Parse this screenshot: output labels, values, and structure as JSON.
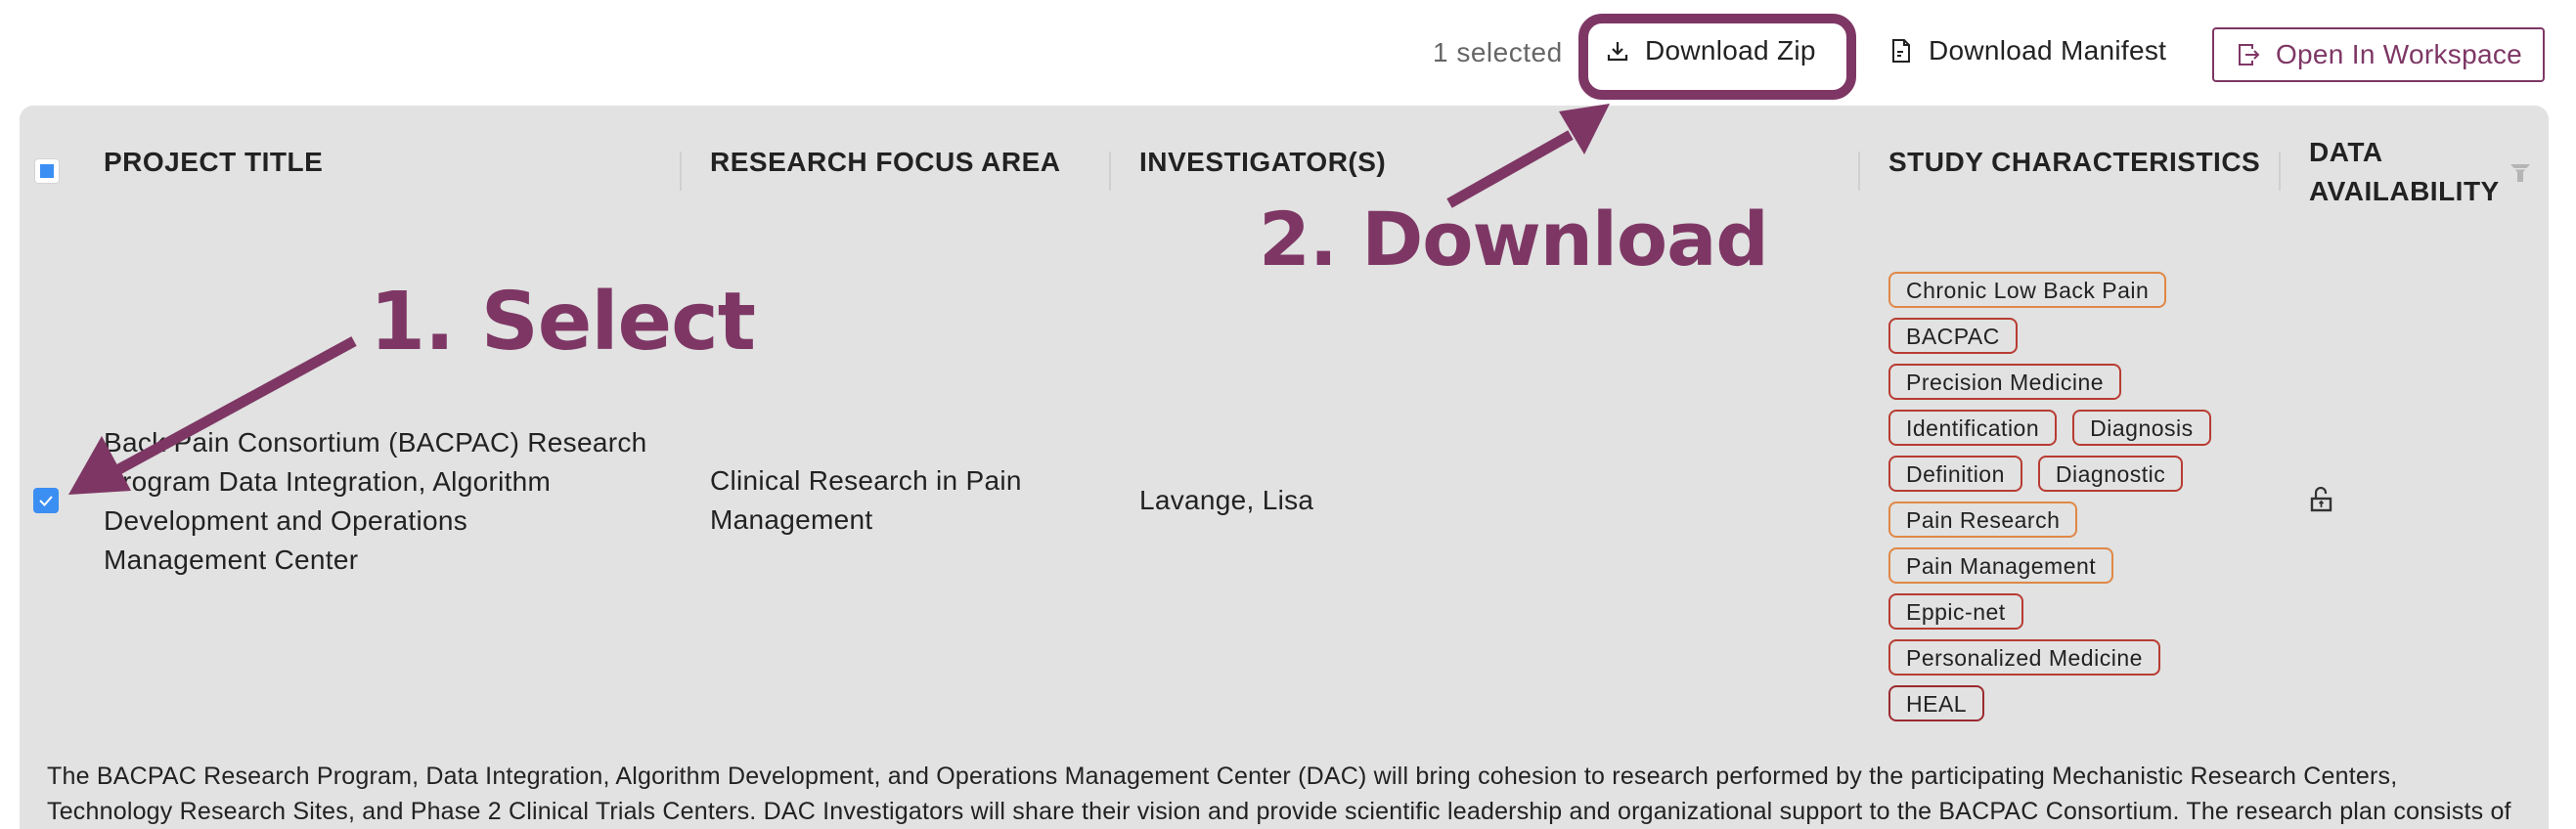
{
  "toolbar": {
    "selected_count": "1 selected",
    "download_zip_label": "Download Zip",
    "download_manifest_label": "Download Manifest",
    "open_workspace_label": "Open In Workspace",
    "icons": {
      "download_zip": "download-icon",
      "download_manifest": "document-icon",
      "open_workspace": "export-icon"
    }
  },
  "table": {
    "columns": [
      {
        "label": "PROJECT TITLE"
      },
      {
        "label": "RESEARCH FOCUS AREA"
      },
      {
        "label": "INVESTIGATOR(S)"
      },
      {
        "label": "STUDY CHARACTERISTICS"
      },
      {
        "label": "DATA AVAILABILITY",
        "line1": "DATA",
        "line2": "AVAILABILITY",
        "icon": "filter-icon"
      }
    ],
    "header_checkbox_state": "indeterminate",
    "rows": [
      {
        "selected": true,
        "title_lines": [
          "Back Pain Consortium (BACPAC) Research",
          "Program Data Integration, Algorithm",
          "Development and Operations",
          "Management Center"
        ],
        "title": "Back Pain Consortium (BACPAC) Research Program Data Integration, Algorithm Development and Operations Management Center",
        "focus_area_lines": [
          "Clinical Research in Pain",
          "Management"
        ],
        "investigators": "Lavange, Lisa",
        "study_characteristics": [
          [
            {
              "label": "Chronic Low Back Pain",
              "color": "#e08746"
            }
          ],
          [
            {
              "label": "BACPAC",
              "color": "#b83c33"
            }
          ],
          [
            {
              "label": "Precision Medicine",
              "color": "#b83c33"
            }
          ],
          [
            {
              "label": "Identification",
              "color": "#b83c33"
            },
            {
              "label": "Diagnosis",
              "color": "#b83c33"
            }
          ],
          [
            {
              "label": "Definition",
              "color": "#b83c33"
            },
            {
              "label": "Diagnostic",
              "color": "#b83c33"
            }
          ],
          [
            {
              "label": "Pain Research",
              "color": "#e08746"
            }
          ],
          [
            {
              "label": "Pain Management",
              "color": "#e08746"
            }
          ],
          [
            {
              "label": "Eppic-net",
              "color": "#b83c33"
            }
          ],
          [
            {
              "label": "Personalized Medicine",
              "color": "#b83c33"
            }
          ],
          [
            {
              "label": "HEAL",
              "color": "#9c2a30"
            }
          ]
        ],
        "data_availability_icon": "unlocked-icon",
        "description_lines": [
          "The BACPAC Research Program, Data Integration, Algorithm Development, and Operations Management Center (DAC) will bring cohesion to research performed by the participating Mechanistic Research Centers,",
          "Technology Research Sites, and Phase 2 Clinical Trials Centers. DAC Investigators will share their vision and provide scientific leadership and organizational support to the BACPAC Consortium. The research plan consists of"
        ]
      }
    ]
  },
  "annotations": {
    "step1": "1. Select",
    "step2": "2. Download",
    "color": "#7e3765"
  },
  "colors": {
    "accent": "#7e3765",
    "checkbox": "#3b8ef2",
    "panel_bg": "#e1e2e1",
    "tag_red": "#b83c33",
    "tag_orange": "#e08746",
    "tag_dark_red": "#9c2a30"
  }
}
